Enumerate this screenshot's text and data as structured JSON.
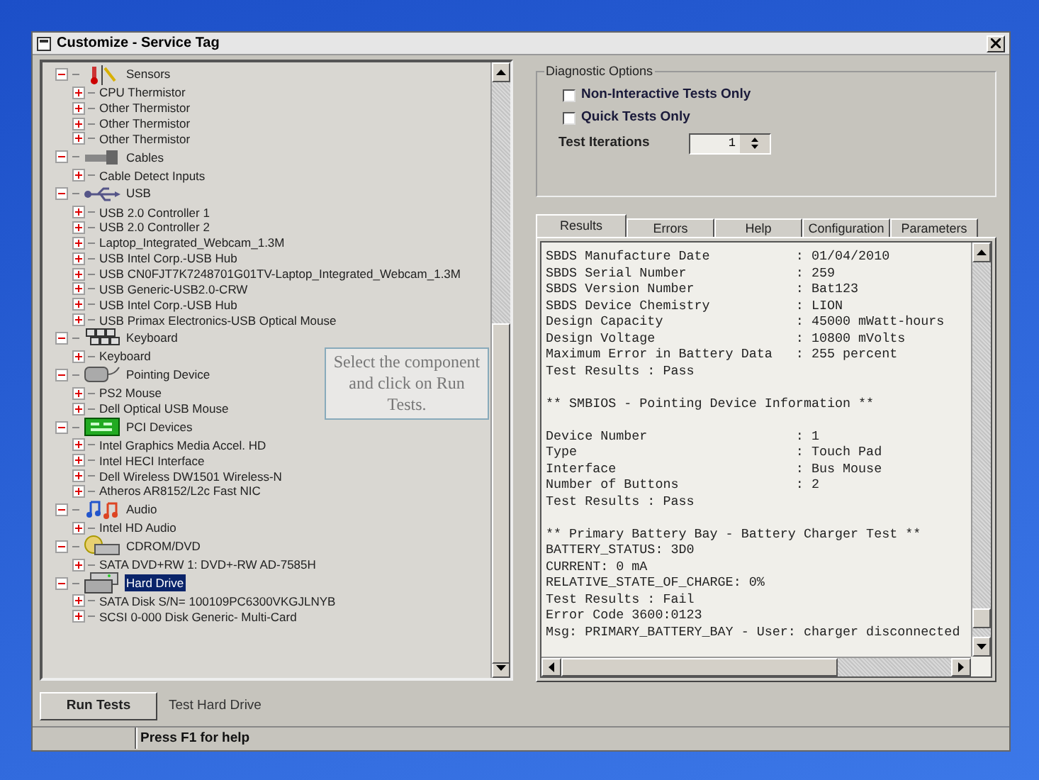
{
  "window": {
    "title": "Customize - Service Tag"
  },
  "tree": [
    {
      "label": "Sensors",
      "expanded": true,
      "selected": false,
      "children": [
        {
          "label": "CPU Thermistor",
          "expanded": false,
          "selected": false
        },
        {
          "label": "Other Thermistor",
          "expanded": false,
          "selected": false
        },
        {
          "label": "Other Thermistor",
          "expanded": false,
          "selected": false
        },
        {
          "label": "Other Thermistor",
          "expanded": false,
          "selected": false
        }
      ]
    },
    {
      "label": "Cables",
      "expanded": true,
      "selected": false,
      "children": [
        {
          "label": "Cable Detect Inputs",
          "expanded": false,
          "selected": false
        }
      ]
    },
    {
      "label": "USB",
      "expanded": true,
      "selected": false,
      "children": [
        {
          "label": "USB 2.0 Controller 1",
          "expanded": false,
          "selected": false
        },
        {
          "label": "USB 2.0 Controller 2",
          "expanded": false,
          "selected": false
        },
        {
          "label": "Laptop_Integrated_Webcam_1.3M",
          "expanded": false,
          "selected": false
        },
        {
          "label": "USB Intel Corp.-USB Hub",
          "expanded": false,
          "selected": false
        },
        {
          "label": "USB CN0FJT7K7248701G01TV-Laptop_Integrated_Webcam_1.3M",
          "expanded": false,
          "selected": false
        },
        {
          "label": "USB Generic-USB2.0-CRW",
          "expanded": false,
          "selected": false
        },
        {
          "label": "USB Intel Corp.-USB Hub",
          "expanded": false,
          "selected": false
        },
        {
          "label": "USB Primax Electronics-USB Optical Mouse",
          "expanded": false,
          "selected": false
        }
      ]
    },
    {
      "label": "Keyboard",
      "expanded": true,
      "selected": false,
      "children": [
        {
          "label": "Keyboard",
          "expanded": false,
          "selected": false
        }
      ]
    },
    {
      "label": "Pointing Device",
      "expanded": true,
      "selected": false,
      "children": [
        {
          "label": "PS2 Mouse",
          "expanded": false,
          "selected": false
        },
        {
          "label": "Dell Optical USB Mouse",
          "expanded": false,
          "selected": false
        }
      ]
    },
    {
      "label": "PCI Devices",
      "expanded": true,
      "selected": false,
      "children": [
        {
          "label": "Intel Graphics Media Accel. HD",
          "expanded": false,
          "selected": false
        },
        {
          "label": "Intel HECI Interface",
          "expanded": false,
          "selected": false
        },
        {
          "label": "Dell Wireless DW1501 Wireless-N",
          "expanded": false,
          "selected": false
        },
        {
          "label": "Atheros AR8152/L2c Fast NIC",
          "expanded": false,
          "selected": false
        }
      ]
    },
    {
      "label": "Audio",
      "expanded": true,
      "selected": false,
      "children": [
        {
          "label": "Intel HD Audio",
          "expanded": false,
          "selected": false
        }
      ]
    },
    {
      "label": "CDROM/DVD",
      "expanded": true,
      "selected": false,
      "children": [
        {
          "label": "SATA DVD+RW 1: DVD+-RW AD-7585H",
          "expanded": false,
          "selected": false
        }
      ]
    },
    {
      "label": "Hard Drive",
      "expanded": true,
      "selected": true,
      "children": [
        {
          "label": "SATA Disk S/N= 100109PC6300VKGJLNYB",
          "expanded": false,
          "selected": false
        },
        {
          "label": "SCSI 0-000 Disk Generic- Multi-Card",
          "expanded": false,
          "selected": false
        }
      ]
    }
  ],
  "diagnostic_options": {
    "title": "Diagnostic Options",
    "checkboxes": [
      {
        "label": "Non-Interactive Tests Only",
        "checked": false
      },
      {
        "label": "Quick Tests Only",
        "checked": false
      }
    ],
    "iterations_label": "Test Iterations",
    "iterations_value": "1"
  },
  "tabs": [
    {
      "label": "Results",
      "selected": true
    },
    {
      "label": "Errors",
      "selected": false
    },
    {
      "label": "Help",
      "selected": false
    },
    {
      "label": "Configuration",
      "selected": false
    },
    {
      "label": "Parameters",
      "selected": false
    }
  ],
  "results": [
    [
      "SBDS Manufacture Date           : 01/04/2010",
      "SBDS Serial Number              : 259",
      "SBDS Version Number             : Bat123",
      "SBDS Device Chemistry           : LION",
      "Design Capacity                 : 45000 mWatt-hours",
      "Design Voltage                  : 10800 mVolts",
      "Maximum Error in Battery Data   : 255 percent",
      "Test Results : Pass"
    ],
    [
      "** SMBIOS - Pointing Device Information **"
    ],
    [
      "Device Number                   : 1",
      "Type                            : Touch Pad",
      "Interface                       : Bus Mouse",
      "Number of Buttons               : 2",
      "Test Results : Pass"
    ],
    [
      "** Primary Battery Bay - Battery Charger Test **",
      "BATTERY_STATUS: 3D0",
      "CURRENT: 0 mA",
      "RELATIVE_STATE_OF_CHARGE: 0%",
      "Test Results : Fail",
      "Error Code 3600:0123",
      "Msg: PRIMARY_BATTERY_BAY - User: charger disconnected"
    ]
  ],
  "tooltip": "Select the component and click on Run Tests.",
  "run_button": "Run Tests",
  "current_test": "Test Hard Drive",
  "status_bar": "Press F1 for help"
}
